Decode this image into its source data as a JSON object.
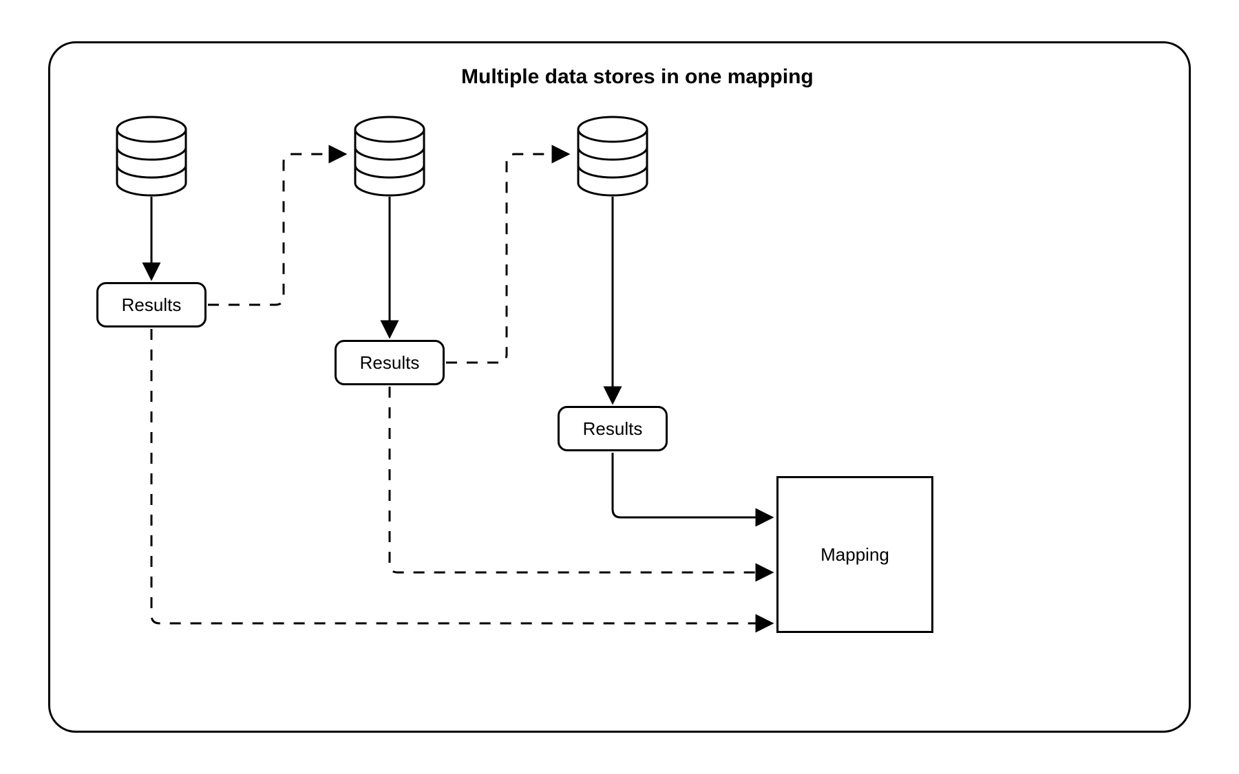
{
  "title": "Multiple data stores in one mapping",
  "nodes": {
    "db1": {
      "type": "database"
    },
    "db2": {
      "type": "database"
    },
    "db3": {
      "type": "database"
    },
    "results1": {
      "label": "Results"
    },
    "results2": {
      "label": "Results"
    },
    "results3": {
      "label": "Results"
    },
    "mapping": {
      "label": "Mapping"
    }
  },
  "edges": [
    {
      "from": "db1",
      "to": "results1",
      "style": "solid"
    },
    {
      "from": "db2",
      "to": "results2",
      "style": "solid"
    },
    {
      "from": "db3",
      "to": "results3",
      "style": "solid"
    },
    {
      "from": "results1",
      "to": "db2",
      "style": "dashed"
    },
    {
      "from": "results2",
      "to": "db3",
      "style": "dashed"
    },
    {
      "from": "results3",
      "to": "mapping",
      "style": "solid"
    },
    {
      "from": "results2",
      "to": "mapping",
      "style": "dashed"
    },
    {
      "from": "results1",
      "to": "mapping",
      "style": "dashed"
    }
  ]
}
